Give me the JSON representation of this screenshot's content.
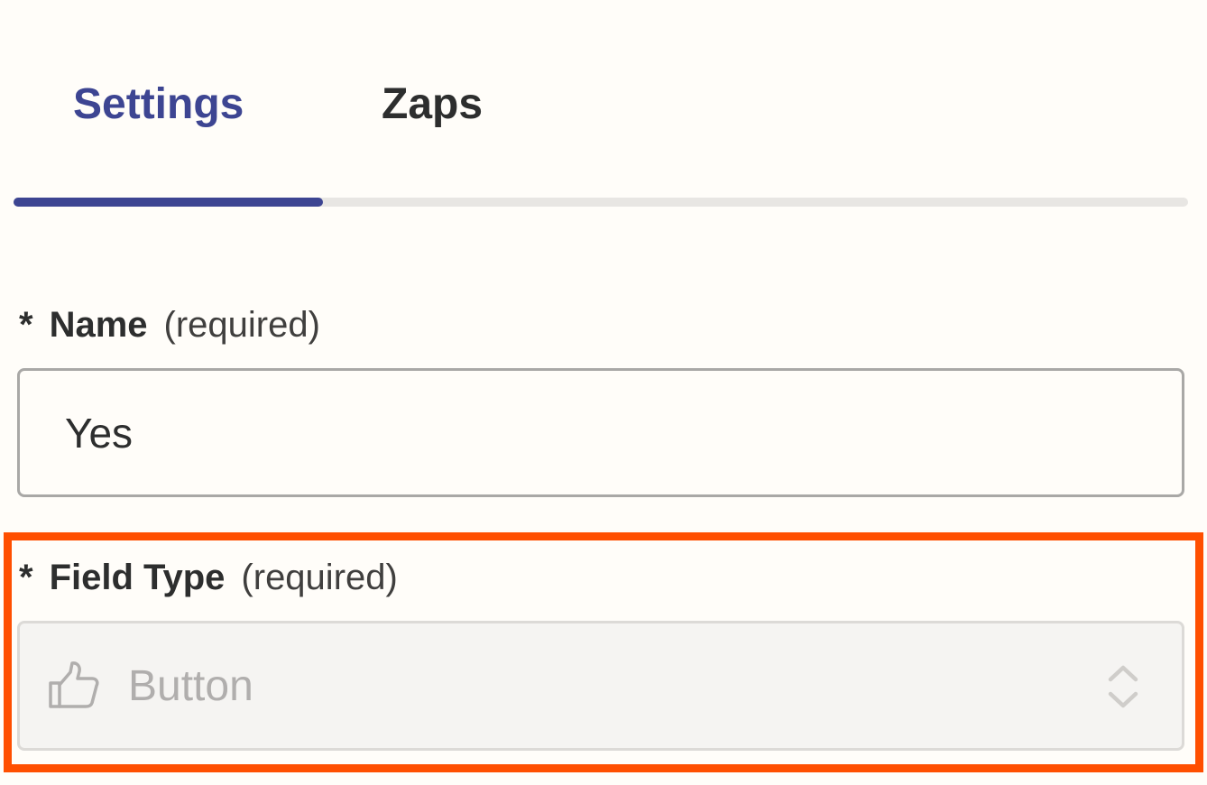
{
  "tabs": {
    "settings": "Settings",
    "zaps": "Zaps",
    "active": "Settings",
    "accent_color": "#3d4592"
  },
  "name_field": {
    "asterisk": "*",
    "label": "Name",
    "required_text": "(required)",
    "value": "Yes"
  },
  "field_type": {
    "asterisk": "*",
    "label": "Field Type",
    "required_text": "(required)",
    "selected_value": "Button",
    "icon": "thumbs-up-icon",
    "disabled": true,
    "highlight_color": "#ff4f00"
  }
}
